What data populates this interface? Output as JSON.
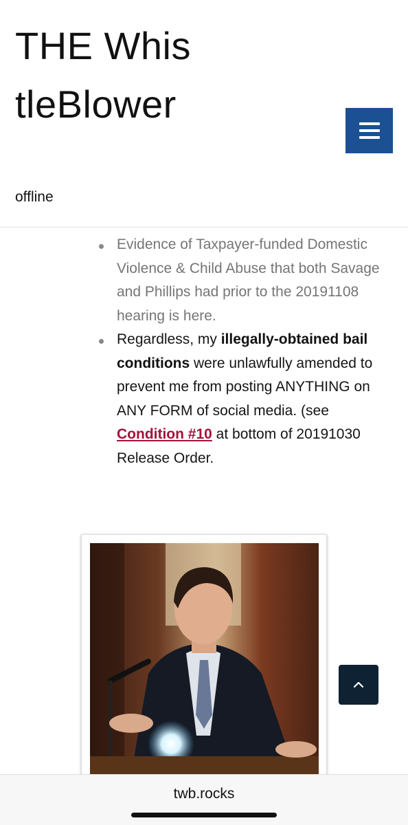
{
  "header": {
    "title": "THE WhistleBlower",
    "tagline": "offline"
  },
  "menu": {
    "icon": "hamburger-menu-icon",
    "color": "#1b5093"
  },
  "bullets": [
    {
      "text": "Evidence of Taxpayer-funded Domestic Violence & Child Abuse that both Savage and Phillips had prior to the 20191108 hearing is here."
    },
    {
      "pre": "Regardless, my ",
      "bold": "illegally-obtained bail conditions",
      "mid": " were unlawfully amended to prevent me from posting ANYTHING on ANY FORM of social media. (see ",
      "link": "Condition #10",
      "post": " at bottom of 20191030 Release Order."
    }
  ],
  "link_color": "#a3123a",
  "scroll_top": {
    "icon": "chevron-up-icon",
    "color": "#0e2233"
  },
  "browser": {
    "url": "twb.rocks"
  }
}
